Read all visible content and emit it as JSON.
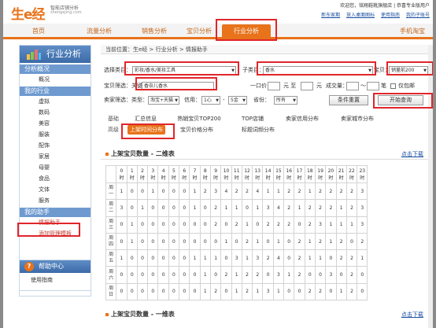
{
  "header": {
    "logo": "生e经",
    "logo_sub": "智能店铺分析",
    "logo_url": "shengejing.com",
    "welcome": "欢迎您，铭翔鞋靴旗舰店 | 恭喜专业版用户",
    "links": [
      "新东家期",
      "放入桌面图标",
      "使用指南",
      "我的子账号"
    ]
  },
  "nav": {
    "tabs": [
      "首页",
      "流量分析",
      "销售分析",
      "宝贝分析",
      "行业分析"
    ],
    "active": "行业分析",
    "mobile": "手机淘宝"
  },
  "sidebar": {
    "title": "行业分析",
    "sections": [
      {
        "label": "分析概况",
        "items": [
          "概况"
        ]
      },
      {
        "label": "我的行业",
        "items": [
          "虚拟",
          "数码",
          "美容",
          "服装",
          "配饰",
          "家居",
          "母婴",
          "食品",
          "文体",
          "服务"
        ]
      },
      {
        "label": "我的助手",
        "items": [
          "情报助手",
          "添加管理模板"
        ]
      }
    ],
    "help_title": "帮助中心",
    "help_items": [
      "使用指南"
    ]
  },
  "breadcrumb": "当前位置：生e经 > 行业分析 > 情报助手",
  "filters": {
    "category_label": "选择类目：",
    "category_value": "彩妆/香水/美妆工具",
    "subcategory_label": "子类目：",
    "subcategory_value": "香水",
    "item_label": "宝贝：",
    "item_value": "销量前200",
    "search_label": "宝贝筛选：关键字",
    "keyword_value": "香奈儿香水",
    "price_label": "一口价：",
    "price_yuan_1": "元 至",
    "price_yuan_2": "元",
    "deals_label": "成交量：",
    "deals_to": "～",
    "deals_unit": "笔",
    "include_label": "仅包邮",
    "seller_label": "卖家筛选：类型：",
    "seller_type": "淘宝+天猫",
    "credit_label": "信用：",
    "credit_from": "1心",
    "credit_to": "5金",
    "province_label": "省份：",
    "province_value": "所有",
    "reset_button": "条件重置",
    "query_button": "开始查询"
  },
  "function_tabs": {
    "groups": [
      "基础",
      "高级"
    ],
    "basic": [
      "汇总信息",
      "热销宝贝TOP200",
      "TOP店铺",
      "卖家信用分布",
      "卖家城市分布"
    ],
    "advanced": [
      "上架时间分布",
      "宝贝价格分布",
      "标题词频分布"
    ],
    "active": "上架时间分布"
  },
  "section1": {
    "title": "上架宝贝数量 - 二维表",
    "download": "点击下载"
  },
  "section2": {
    "title": "上架宝贝数量 - 一维表",
    "download": "点击下载"
  },
  "hour_unit": "时",
  "chart_data": {
    "type": "table",
    "title": "上架宝贝数量 - 二维表",
    "columns": [
      "0",
      "1",
      "2",
      "3",
      "4",
      "5",
      "6",
      "7",
      "8",
      "9",
      "10",
      "11",
      "12",
      "13",
      "14",
      "15",
      "16",
      "17",
      "18",
      "19",
      "20",
      "21",
      "22",
      "23"
    ],
    "rows": [
      {
        "day": "周一",
        "values": [
          1,
          0,
          0,
          1,
          0,
          0,
          0,
          1,
          2,
          3,
          4,
          2,
          2,
          4,
          1,
          1,
          2,
          2,
          1,
          2,
          2,
          2,
          2,
          3
        ]
      },
      {
        "day": "周二",
        "values": [
          3,
          0,
          1,
          0,
          0,
          0,
          0,
          1,
          0,
          2,
          1,
          1,
          0,
          1,
          3,
          4,
          2,
          1,
          2,
          2,
          2,
          1,
          2,
          3
        ]
      },
      {
        "day": "周三",
        "values": [
          0,
          1,
          0,
          0,
          0,
          0,
          0,
          0,
          0,
          2,
          0,
          2,
          1,
          0,
          2,
          2,
          2,
          0,
          2,
          3,
          1,
          1,
          1,
          3
        ]
      },
      {
        "day": "周四",
        "values": [
          0,
          1,
          0,
          0,
          0,
          0,
          0,
          0,
          0,
          0,
          1,
          0,
          2,
          1,
          0,
          1,
          0,
          2,
          1,
          2,
          1,
          2,
          0,
          2
        ]
      },
      {
        "day": "周五",
        "values": [
          1,
          0,
          0,
          0,
          0,
          0,
          0,
          1,
          1,
          1,
          0,
          3,
          1,
          3,
          2,
          4,
          0,
          2,
          1,
          1,
          0,
          2,
          2,
          1
        ]
      },
      {
        "day": "周六",
        "values": [
          0,
          0,
          0,
          0,
          0,
          0,
          0,
          0,
          1,
          0,
          2,
          1,
          2,
          2,
          0,
          3,
          1,
          2,
          0,
          0,
          3,
          0,
          2,
          0
        ]
      },
      {
        "day": "周日",
        "values": [
          0,
          0,
          0,
          0,
          0,
          0,
          0,
          0,
          1,
          2,
          0,
          1,
          2,
          1,
          3,
          1,
          0,
          0,
          2,
          2,
          0,
          1,
          2,
          0
        ]
      }
    ]
  }
}
